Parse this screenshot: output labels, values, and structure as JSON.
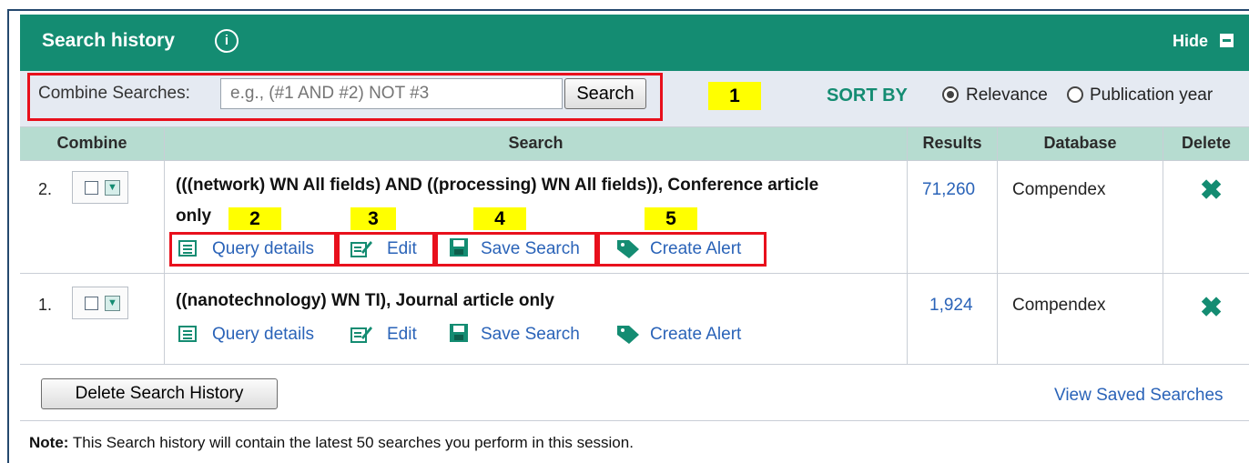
{
  "panel": {
    "title": "Search history",
    "hide_label": "Hide"
  },
  "toolbar": {
    "combine_label": "Combine Searches:",
    "combine_placeholder": "e.g., (#1 AND #2) NOT #3",
    "search_button": "Search",
    "sort_by_label": "SORT BY",
    "sort_options": [
      {
        "label": "Relevance",
        "selected": true
      },
      {
        "label": "Publication year",
        "selected": false
      }
    ]
  },
  "callouts": [
    "1",
    "2",
    "3",
    "4",
    "5"
  ],
  "table": {
    "headers": [
      "Combine",
      "Search",
      "Results",
      "Database",
      "Delete"
    ],
    "rows": [
      {
        "number": "2.",
        "query_line1": "(((network) WN All fields) AND ((processing) WN All fields)), Conference article",
        "query_line2": "only",
        "results": "71,260",
        "database": "Compendex",
        "actions": [
          "Query details",
          "Edit",
          "Save Search",
          "Create Alert"
        ]
      },
      {
        "number": "1.",
        "query_line1": "((nanotechnology) WN TI), Journal article only",
        "results": "1,924",
        "database": "Compendex",
        "actions": [
          "Query details",
          "Edit",
          "Save Search",
          "Create Alert"
        ]
      }
    ]
  },
  "footer": {
    "delete_history_button": "Delete Search History",
    "view_saved_link": "View Saved Searches",
    "note_label": "Note:",
    "note_text": " This Search history will contain the latest 50 searches you perform in this session."
  },
  "colors": {
    "header_green": "#148c72",
    "highlight_red": "#e8101c",
    "callout_yellow": "#ffff00",
    "link_blue": "#2a63b8"
  },
  "icons": [
    "info-icon",
    "hide-icon",
    "query-details-icon",
    "edit-icon",
    "save-icon",
    "alert-tag-icon",
    "delete-x-icon",
    "dropdown-chevron-icon"
  ]
}
